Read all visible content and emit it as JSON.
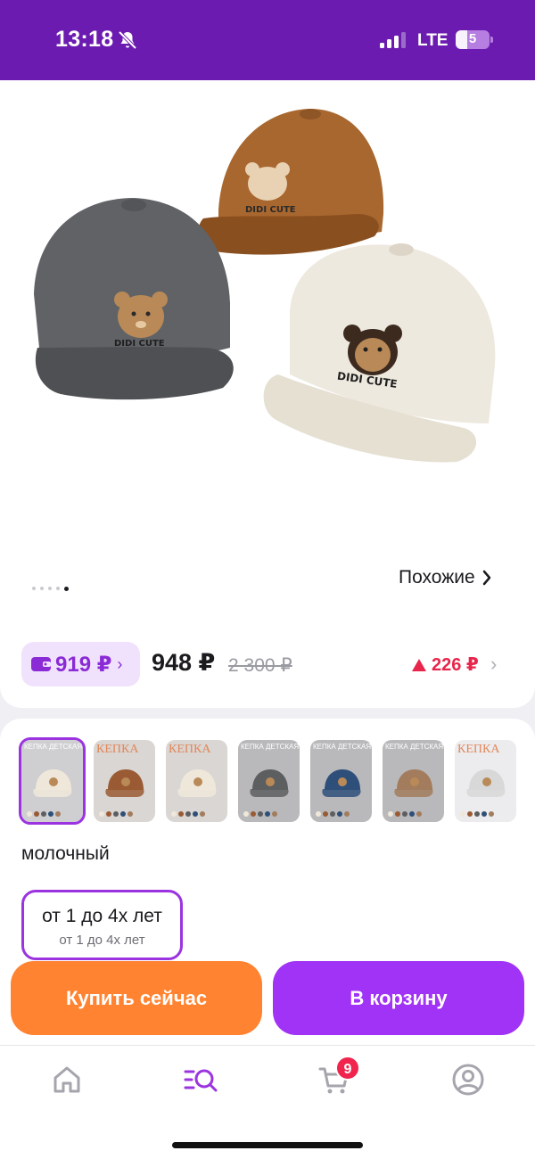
{
  "status_bar": {
    "time": "13:18",
    "network": "LTE",
    "battery": "5"
  },
  "product": {
    "similar_label": "Похожие",
    "gallery": {
      "total_images": 5,
      "current_index": 5
    },
    "image_text": "DIDI CUTE",
    "wallet_price": "919 ₽",
    "price": "948 ₽",
    "old_price": "2 300 ₽",
    "price_change": "226 ₽"
  },
  "variants": {
    "thumbnails": [
      {
        "header": "КЕПКА ДЕТСКАЯ",
        "cap_color": "#efe8da",
        "bg": "#cfcfd2",
        "selected": true
      },
      {
        "header": "КЕПКА",
        "cap_color": "#9a5a33",
        "bg": "#d9d6d3",
        "selected": false
      },
      {
        "header": "КЕПКА",
        "cap_color": "#efe8da",
        "bg": "#d9d6d3",
        "selected": false
      },
      {
        "header": "КЕПКА ДЕТСКАЯ",
        "cap_color": "#5d5e60",
        "bg": "#b9b9bc",
        "selected": false
      },
      {
        "header": "КЕПКА ДЕТСКАЯ",
        "cap_color": "#2e4f79",
        "bg": "#b9b9bc",
        "selected": false
      },
      {
        "header": "КЕПКА ДЕТСКАЯ",
        "cap_color": "#a27c5c",
        "bg": "#b9b9bc",
        "selected": false
      },
      {
        "header": "КЕПКА",
        "cap_color": "#d8d8d8",
        "bg": "#ececee",
        "selected": false
      }
    ],
    "color_name": "молочный",
    "size": {
      "label": "от 1 до 4х лет",
      "sublabel": "от 1 до 4х лет"
    }
  },
  "actions": {
    "buy_now": "Купить сейчас",
    "add_to_cart": "В корзину"
  },
  "tabbar": {
    "cart_badge": "9",
    "active_tab": "catalog"
  },
  "colors": {
    "brand": "#6c1bb0",
    "accent": "#a033f5",
    "buy": "#ff8330",
    "price_up": "#e8264c"
  }
}
